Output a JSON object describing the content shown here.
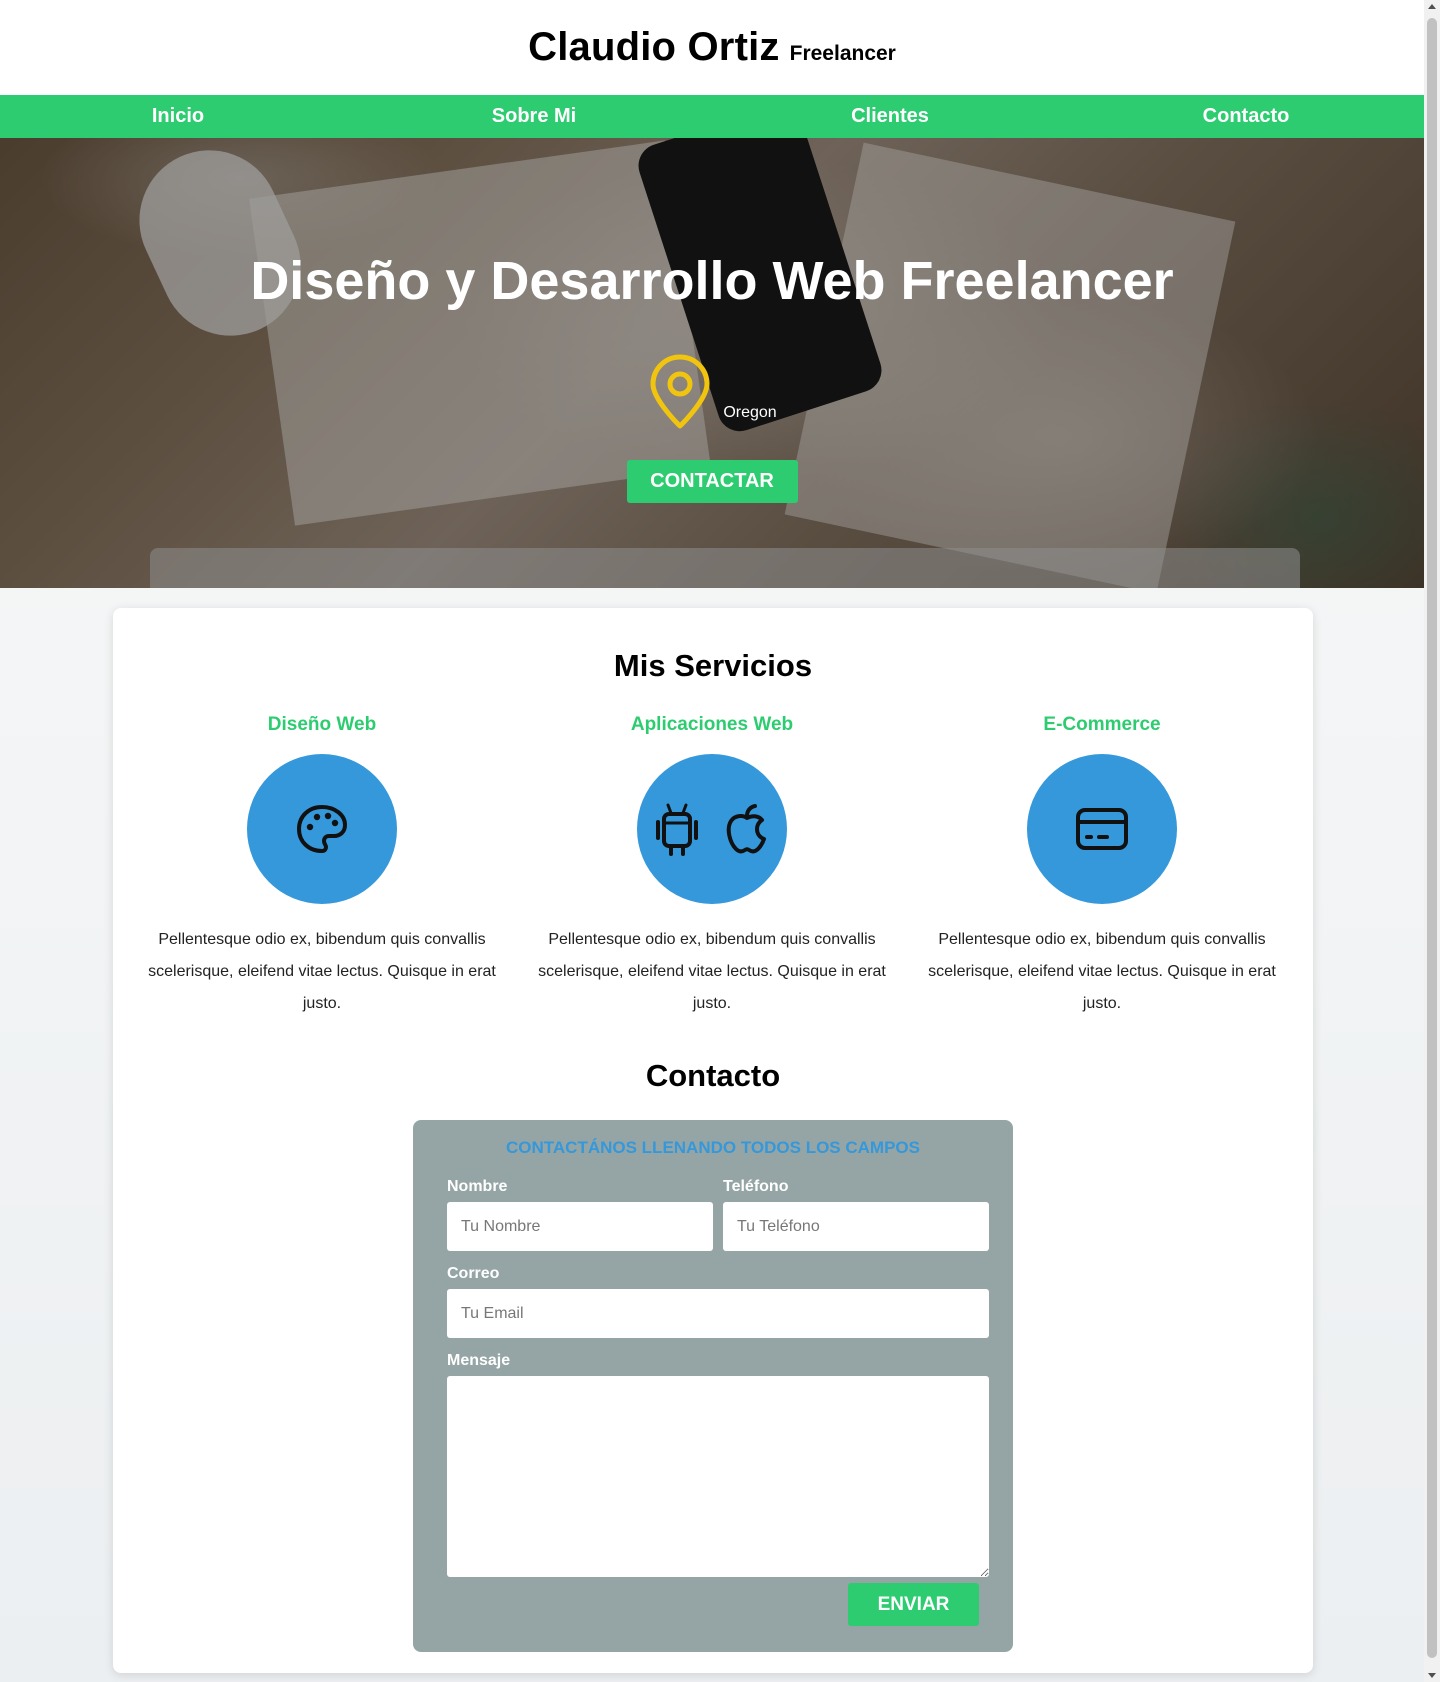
{
  "header": {
    "name": "Claudio Ortiz",
    "tagline": "Freelancer"
  },
  "nav": {
    "items": [
      "Inicio",
      "Sobre Mi",
      "Clientes",
      "Contacto"
    ]
  },
  "hero": {
    "title": "Diseño y Desarrollo Web Freelancer",
    "location": "Oregon",
    "location_icon": "map-pin-icon",
    "cta": "CONTACTAR"
  },
  "services": {
    "title": "Mis Servicios",
    "items": [
      {
        "name": "Diseño Web",
        "icon": "palette-icon",
        "text": "Pellentesque odio ex, bibendum quis convallis scelerisque, eleifend vitae lectus. Quisque in erat justo."
      },
      {
        "name": "Aplicaciones Web",
        "icon": "android-icon, apple-icon",
        "text": "Pellentesque odio ex, bibendum quis convallis scelerisque, eleifend vitae lectus. Quisque in erat justo."
      },
      {
        "name": "E-Commerce",
        "icon": "credit-card-icon",
        "text": "Pellentesque odio ex, bibendum quis convallis scelerisque, eleifend vitae lectus. Quisque in erat justo."
      }
    ]
  },
  "contact": {
    "title": "Contacto",
    "legend": "CONTACTÁNOS LLENANDO TODOS LOS CAMPOS",
    "fields": {
      "nombre": {
        "label": "Nombre",
        "placeholder": "Tu Nombre",
        "value": ""
      },
      "telefono": {
        "label": "Teléfono",
        "placeholder": "Tu Teléfono",
        "value": ""
      },
      "correo": {
        "label": "Correo",
        "placeholder": "Tu Email",
        "value": ""
      },
      "mensaje": {
        "label": "Mensaje",
        "value": ""
      }
    },
    "submit": "ENVIAR"
  },
  "colors": {
    "accent_green": "#2ecc71",
    "accent_blue": "#3498db",
    "form_bg": "#95a5a6",
    "pin_yellow": "#f1c40f"
  }
}
